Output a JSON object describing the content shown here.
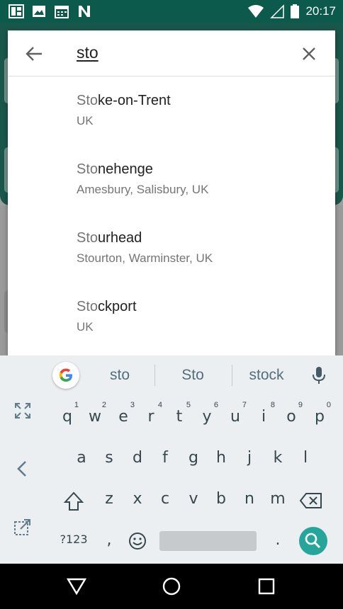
{
  "status_bar": {
    "time": "20:17",
    "left_icons": [
      "photo-collage-icon",
      "image-icon",
      "calendar-icon",
      "n-logo-icon"
    ],
    "right_icons": [
      "wifi-icon",
      "signal-icon",
      "battery-icon"
    ]
  },
  "search": {
    "query": "sto",
    "results": [
      {
        "match": "Sto",
        "rest": "ke-on-Trent",
        "subtitle": "UK"
      },
      {
        "match": "Sto",
        "rest": "nehenge",
        "subtitle": "Amesbury, Salisbury, UK"
      },
      {
        "match": "Sto",
        "rest": "urhead",
        "subtitle": "Stourton, Warminster, UK"
      },
      {
        "match": "Sto",
        "rest": "ckport",
        "subtitle": "UK"
      }
    ]
  },
  "keyboard": {
    "suggestions": [
      "sto",
      "Sto",
      "stock"
    ],
    "row1": [
      {
        "ch": "q",
        "hint": "1"
      },
      {
        "ch": "w",
        "hint": "2"
      },
      {
        "ch": "e",
        "hint": "3"
      },
      {
        "ch": "r",
        "hint": "4"
      },
      {
        "ch": "t",
        "hint": "5"
      },
      {
        "ch": "y",
        "hint": "6"
      },
      {
        "ch": "u",
        "hint": "7"
      },
      {
        "ch": "i",
        "hint": "8"
      },
      {
        "ch": "o",
        "hint": "9"
      },
      {
        "ch": "p",
        "hint": "0"
      }
    ],
    "row2": [
      "a",
      "s",
      "d",
      "f",
      "g",
      "h",
      "j",
      "k",
      "l"
    ],
    "row3": [
      "z",
      "x",
      "c",
      "v",
      "b",
      "n",
      "m"
    ],
    "symbols_label": "?123",
    "comma": ",",
    "period": ".",
    "accent_color": "#26a69a"
  },
  "colors": {
    "status_bar": "#0c5a4c",
    "app_header": "#19574b",
    "keyboard_bg": "#eceff1",
    "text_primary": "#212121",
    "text_secondary": "#757575"
  }
}
